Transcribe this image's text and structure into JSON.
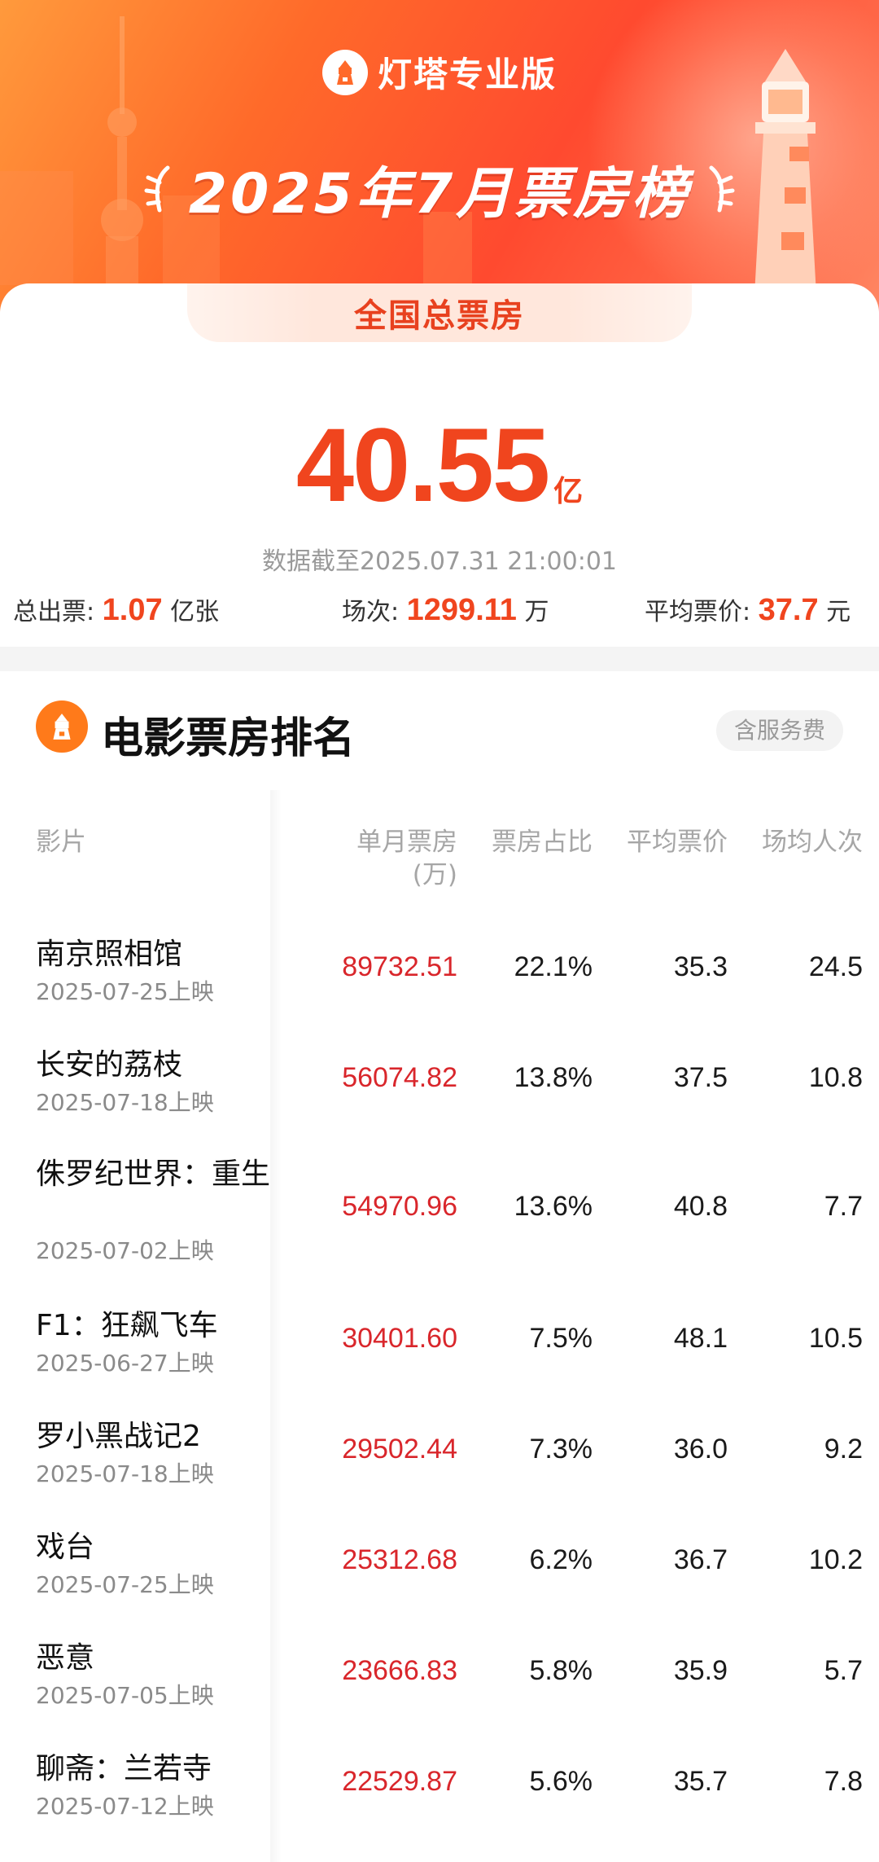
{
  "brand": {
    "name": "灯塔专业版"
  },
  "banner": {
    "title": "2025年7月票房榜"
  },
  "summary": {
    "tab_label": "全国总票房",
    "total_value": "40.55",
    "total_unit": "亿",
    "as_of": "数据截至2025.07.31 21:00:01",
    "tickets_label": "总出票:",
    "tickets_value": "1.07",
    "tickets_unit": "亿张",
    "shows_label": "场次:",
    "shows_value": "1299.11",
    "shows_unit": "万",
    "avg_price_label": "平均票价:",
    "avg_price_value": "37.7",
    "avg_price_unit": "元"
  },
  "ranking": {
    "title": "电影票房排名",
    "fee_note": "含服务费",
    "headers": {
      "film": "影片",
      "box_office": "单月票房",
      "box_office_unit": "(万)",
      "share": "票房占比",
      "avg_price": "平均票价",
      "avg_attendance": "场均人次"
    },
    "rows": [
      {
        "name": "南京照相馆",
        "date": "2025-07-25上映",
        "box_office": "89732.51",
        "share": "22.1%",
        "avg_price": "35.3",
        "avg_attendance": "24.5"
      },
      {
        "name": "长安的荔枝",
        "date": "2025-07-18上映",
        "box_office": "56074.82",
        "share": "13.8%",
        "avg_price": "37.5",
        "avg_attendance": "10.8"
      },
      {
        "name": "侏罗纪世界：重生",
        "date": "2025-07-02上映",
        "box_office": "54970.96",
        "share": "13.6%",
        "avg_price": "40.8",
        "avg_attendance": "7.7"
      },
      {
        "name": "F1：狂飙飞车",
        "date": "2025-06-27上映",
        "box_office": "30401.60",
        "share": "7.5%",
        "avg_price": "48.1",
        "avg_attendance": "10.5"
      },
      {
        "name": "罗小黑战记2",
        "date": "2025-07-18上映",
        "box_office": "29502.44",
        "share": "7.3%",
        "avg_price": "36.0",
        "avg_attendance": "9.2"
      },
      {
        "name": "戏台",
        "date": "2025-07-25上映",
        "box_office": "25312.68",
        "share": "6.2%",
        "avg_price": "36.7",
        "avg_attendance": "10.2"
      },
      {
        "name": "恶意",
        "date": "2025-07-05上映",
        "box_office": "23666.83",
        "share": "5.8%",
        "avg_price": "35.9",
        "avg_attendance": "5.7"
      },
      {
        "name": "聊斋：兰若寺",
        "date": "2025-07-12上映",
        "box_office": "22529.87",
        "share": "5.6%",
        "avg_price": "35.7",
        "avg_attendance": "7.8"
      }
    ]
  },
  "colors": {
    "accent": "#f0451e",
    "box_office_red": "#d9262b",
    "muted": "#8a8a8a"
  }
}
